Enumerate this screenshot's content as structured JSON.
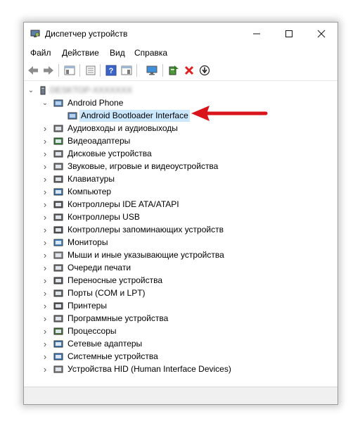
{
  "window": {
    "title": "Диспетчер устройств"
  },
  "menu": [
    "Файл",
    "Действие",
    "Вид",
    "Справка"
  ],
  "colors": {
    "selection": "#cce8ff",
    "arrow": "#d9141b",
    "delete": "#e02020"
  },
  "tree": {
    "root_label": "DESKTOP-XXXXXXX",
    "expanded": {
      "label": "Android Phone",
      "child": "Android Bootloader Interface"
    },
    "categories": [
      "Аудиовходы и аудиовыходы",
      "Видеоадаптеры",
      "Дисковые устройства",
      "Звуковые, игровые и видеоустройства",
      "Клавиатуры",
      "Компьютер",
      "Контроллеры IDE ATA/ATAPI",
      "Контроллеры USB",
      "Контроллеры запоминающих устройств",
      "Мониторы",
      "Мыши и иные указывающие устройства",
      "Очереди печати",
      "Переносные устройства",
      "Порты (COM и LPT)",
      "Принтеры",
      "Программные устройства",
      "Процессоры",
      "Сетевые адаптеры",
      "Системные устройства",
      "Устройства HID (Human Interface Devices)"
    ]
  }
}
